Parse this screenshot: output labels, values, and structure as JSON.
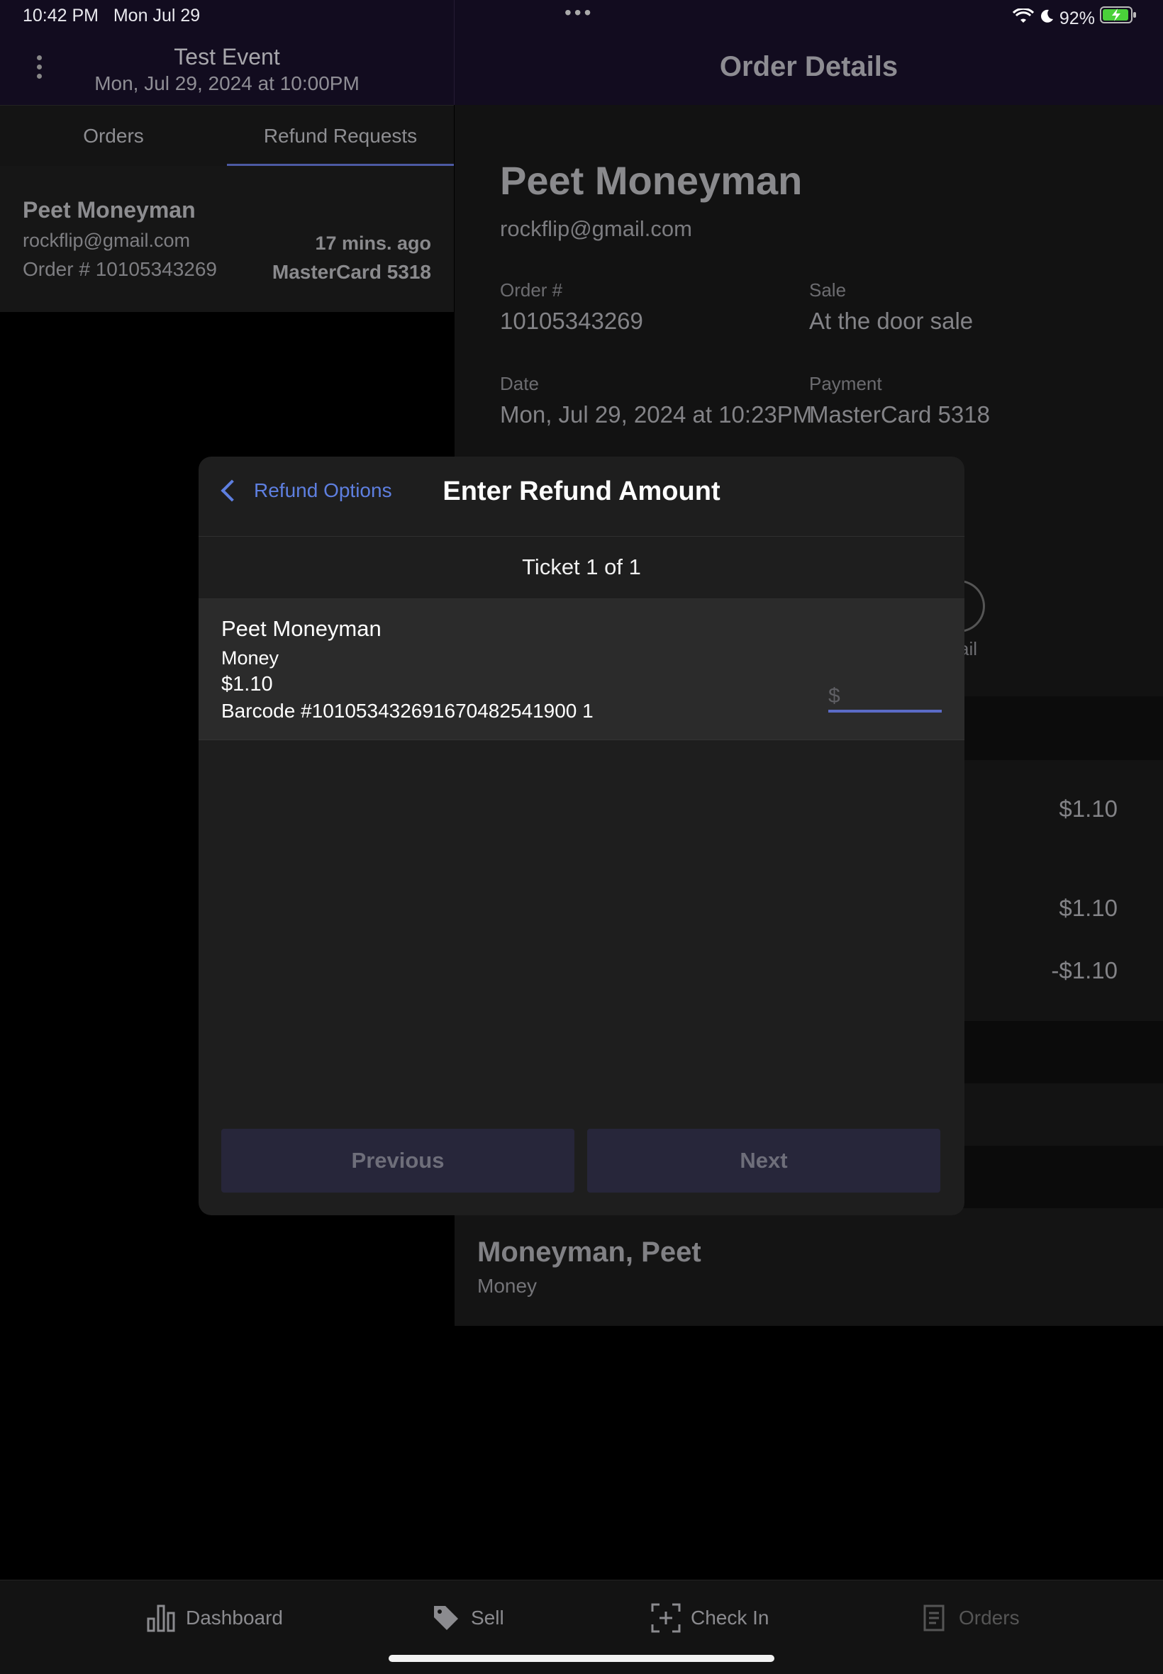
{
  "status_bar": {
    "time": "10:42 PM",
    "date": "Mon Jul 29",
    "battery": "92%"
  },
  "sidebar_header": {
    "event_title": "Test Event",
    "event_date": "Mon, Jul 29, 2024 at 10:00PM"
  },
  "tabs": [
    {
      "label": "Orders",
      "active": false
    },
    {
      "label": "Refund Requests",
      "active": true
    }
  ],
  "refund_list": [
    {
      "name": "Peet Moneyman",
      "email": "rockflip@gmail.com",
      "order": "Order # 10105343269",
      "time_ago": "17 mins. ago",
      "payment": "MasterCard 5318"
    }
  ],
  "order_details": {
    "header_title": "Order Details",
    "name": "Peet Moneyman",
    "email": "rockflip@gmail.com",
    "order_label": "Order #",
    "order_number": "10105343269",
    "sale_label": "Sale",
    "sale_value": "At the door sale",
    "date_label": "Date",
    "date_value": "Mon, Jul 29, 2024 at 10:23PM",
    "payment_label": "Payment",
    "payment_value": "MasterCard 5318",
    "email_action_fragment": "ail",
    "amounts": [
      "$1.10",
      "$1.10",
      "-$1.10"
    ],
    "attendee_name": "Moneyman, Peet",
    "attendee_ticket_type": "Money"
  },
  "modal": {
    "back_label": "Refund Options",
    "title": "Enter Refund Amount",
    "ticket_counter": "Ticket 1 of 1",
    "ticket": {
      "holder": "Peet Moneyman",
      "type": "Money",
      "price": "$1.10",
      "barcode": "Barcode #101053432691670482541900 1"
    },
    "amount_placeholder": "$",
    "previous_label": "Previous",
    "next_label": "Next"
  },
  "bottom_tabs": [
    {
      "label": "Dashboard",
      "icon": "bar-chart-icon"
    },
    {
      "label": "Sell",
      "icon": "tag-icon"
    },
    {
      "label": "Check In",
      "icon": "scan-plus-icon"
    },
    {
      "label": "Orders",
      "icon": "receipt-icon"
    }
  ],
  "colors": {
    "accent": "#5e7fe0",
    "tab_underline": "#4c5aa3",
    "header_bg": "#120c1f"
  }
}
